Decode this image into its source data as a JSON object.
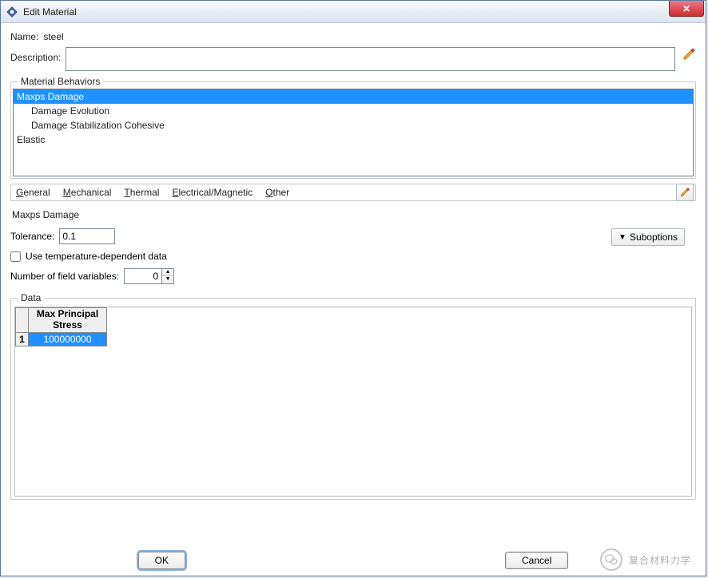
{
  "window": {
    "title": "Edit Material"
  },
  "fields": {
    "name_label": "Name:",
    "name_value": "steel",
    "description_label": "Description:"
  },
  "behaviors": {
    "legend": "Material Behaviors",
    "items": [
      {
        "label": "Maxps Damage",
        "indent": false,
        "selected": true
      },
      {
        "label": "Damage Evolution",
        "indent": true,
        "selected": false
      },
      {
        "label": "Damage Stabilization Cohesive",
        "indent": true,
        "selected": false
      },
      {
        "label": "Elastic",
        "indent": false,
        "selected": false
      }
    ]
  },
  "menus": {
    "general": "General",
    "mechanical": "Mechanical",
    "thermal": "Thermal",
    "electrical": "Electrical/Magnetic",
    "other": "Other"
  },
  "panel": {
    "title": "Maxps Damage",
    "tolerance_label": "Tolerance:",
    "tolerance_value": "0.1",
    "suboptions_label": "Suboptions",
    "temp_dep_label": "Use temperature-dependent data",
    "nfv_label": "Number of field variables:",
    "nfv_value": "0"
  },
  "data": {
    "legend": "Data",
    "header": "Max Principal\nStress",
    "rows": [
      {
        "num": "1",
        "value": "100000000"
      }
    ]
  },
  "buttons": {
    "ok": "OK",
    "cancel": "Cancel"
  },
  "watermark": "复合材料力学"
}
